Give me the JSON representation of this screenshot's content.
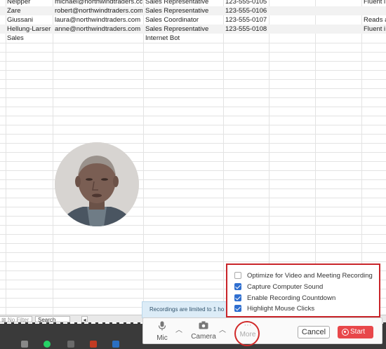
{
  "spreadsheet": {
    "rows": [
      {
        "c1": "Neipper",
        "c2": "michael@northwindtraders.cc",
        "c3": "Sales Representative",
        "c4": "123-555-0105",
        "c5": "Fluent i"
      },
      {
        "c1": "Zare",
        "c2": "robert@northwindtraders.com",
        "c3": "Sales Representative",
        "c4": "123-555-0106",
        "c5": ""
      },
      {
        "c1": "Giussani",
        "c2": "laura@northwindtraders.com",
        "c3": "Sales Coordinator",
        "c4": "123-555-0107",
        "c5": "Reads a"
      },
      {
        "c1": "Hellung-Larser",
        "c2": "anne@northwindtraders.com",
        "c3": "Sales Representative",
        "c4": "123-555-0108",
        "c5": "Fluent i"
      },
      {
        "c1": "Sales",
        "c2": "",
        "c3": "Internet Bot",
        "c4": "",
        "c5": ""
      }
    ]
  },
  "sheet_tabs": {
    "filter_label": "No Filter",
    "search_label": "Search"
  },
  "recorder": {
    "limit_notice": "Recordings are limited to 1 ho",
    "mic_label": "Mic",
    "camera_label": "Camera",
    "more_label": "More",
    "cancel_label": "Cancel",
    "start_label": "Start",
    "accent_color": "#e8474a",
    "highlight_color": "#c9252a"
  },
  "options": [
    {
      "label": "Optimize for Video and Meeting Recording",
      "checked": false
    },
    {
      "label": "Capture Computer Sound",
      "checked": true
    },
    {
      "label": "Enable Recording Countdown",
      "checked": true
    },
    {
      "label": "Highlight Mouse Clicks",
      "checked": true
    }
  ]
}
